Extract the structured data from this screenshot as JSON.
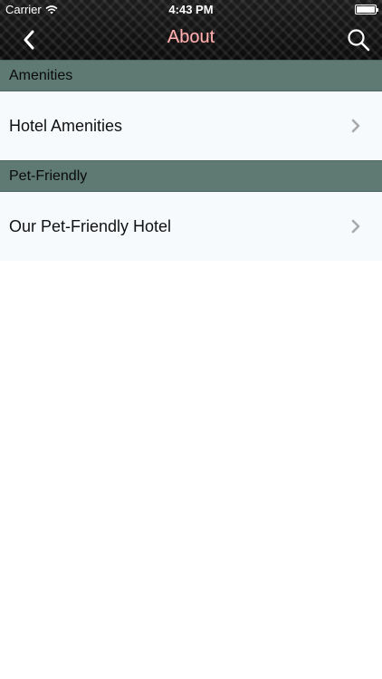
{
  "status_bar": {
    "carrier": "Carrier",
    "time": "4:43 PM"
  },
  "nav": {
    "title": "About",
    "back_icon": "chevron-left-icon",
    "search_icon": "search-icon"
  },
  "sections": [
    {
      "header": "Amenities",
      "items": [
        {
          "label": "Hotel Amenities"
        }
      ]
    },
    {
      "header": "Pet-Friendly",
      "items": [
        {
          "label": "Our Pet-Friendly Hotel"
        }
      ]
    }
  ],
  "colors": {
    "section_header_bg": "#5e7a72",
    "row_bg": "#f6fafd",
    "title_color": "#ffb3b3"
  }
}
